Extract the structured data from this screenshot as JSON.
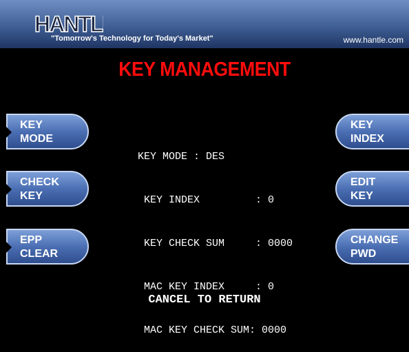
{
  "header": {
    "brand": "HANTLE",
    "tagline": "\"Tomorrow's Technology for Today's Market\"",
    "url": "www.hantle.com"
  },
  "screen": {
    "title": "KEY MANAGEMENT",
    "footer": "CANCEL TO RETURN"
  },
  "left_keys": [
    {
      "line1": "KEY",
      "line2": "MODE"
    },
    {
      "line1": "CHECK",
      "line2": "KEY"
    },
    {
      "line1": "EPP",
      "line2": "CLEAR"
    }
  ],
  "right_keys": [
    {
      "line1": "KEY",
      "line2": "INDEX"
    },
    {
      "line1": "EDIT",
      "line2": "KEY"
    },
    {
      "line1": "CHANGE",
      "line2": "PWD"
    }
  ],
  "info_lines": [
    "KEY MODE : DES",
    " KEY INDEX         : 0",
    " KEY CHECK SUM     : 0000",
    " MAC KEY INDEX     : 0",
    " MAC KEY CHECK SUM: 0000"
  ],
  "colors": {
    "title": "#ff0d0d",
    "button": "#4b6fb3",
    "header": "#3f5f95"
  }
}
